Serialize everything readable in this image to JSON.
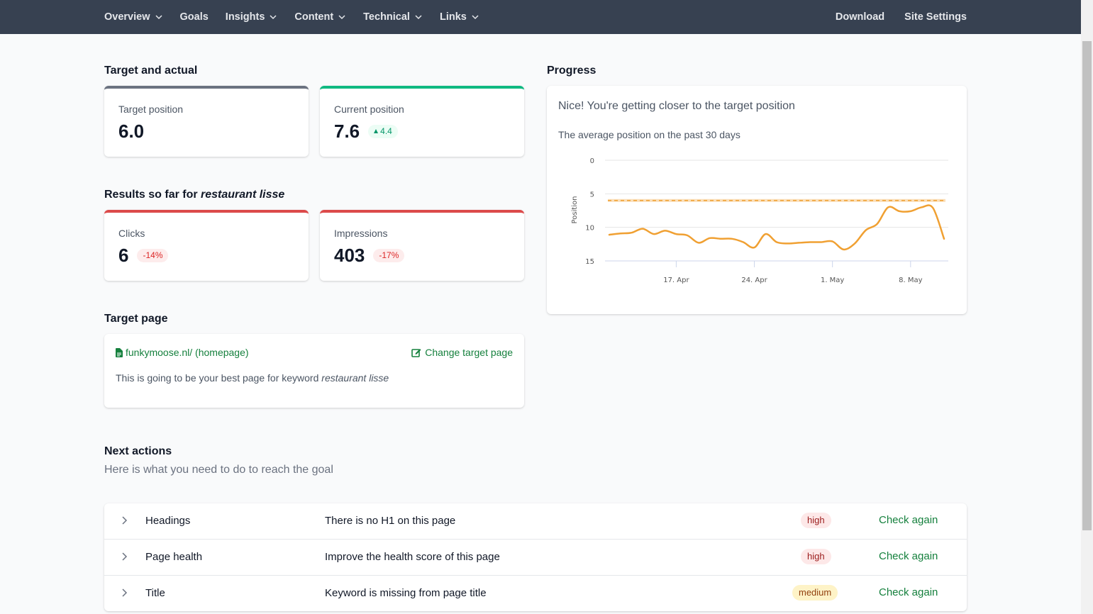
{
  "nav": {
    "left": [
      {
        "label": "Overview",
        "dropdown": true
      },
      {
        "label": "Goals",
        "dropdown": false
      },
      {
        "label": "Insights",
        "dropdown": true
      },
      {
        "label": "Content",
        "dropdown": true
      },
      {
        "label": "Technical",
        "dropdown": true
      },
      {
        "label": "Links",
        "dropdown": true
      }
    ],
    "right": [
      {
        "label": "Download"
      },
      {
        "label": "Site Settings"
      }
    ]
  },
  "target_actual": {
    "title": "Target and actual",
    "target": {
      "label": "Target position",
      "value": "6.0"
    },
    "current": {
      "label": "Current position",
      "value": "7.6",
      "change": "4.4",
      "change_direction": "up"
    }
  },
  "results": {
    "title_prefix": "Results so far for ",
    "keyword": "restaurant lisse",
    "clicks": {
      "label": "Clicks",
      "value": "6",
      "change": "-14%"
    },
    "impressions": {
      "label": "Impressions",
      "value": "403",
      "change": "-17%"
    }
  },
  "target_page": {
    "title": "Target page",
    "link": "funkymoose.nl/ (homepage)",
    "change_label": "Change target page",
    "desc_prefix": "This is going to be your best page for keyword ",
    "keyword": "restaurant lisse"
  },
  "progress": {
    "title": "Progress",
    "headline": "Nice! You're getting closer to the target position",
    "subtitle": "The average position on the past 30 days"
  },
  "chart_data": {
    "type": "line",
    "ylabel": "Position",
    "y_reversed": true,
    "ylim": [
      0,
      15
    ],
    "yticks": [
      "0",
      "5",
      "10",
      "15"
    ],
    "xticks": [
      {
        "date": "2024-04-17",
        "label": "17. Apr"
      },
      {
        "date": "2024-04-24",
        "label": "24. Apr"
      },
      {
        "date": "2024-05-01",
        "label": "1. May"
      },
      {
        "date": "2024-05-08",
        "label": "8. May"
      }
    ],
    "x_start": "2024-04-11",
    "x_end": "2024-05-11",
    "grid": true,
    "target_line": 6.0,
    "series": [
      {
        "color": "#f0a032",
        "points": [
          [
            "2024-04-11",
            11.1
          ],
          [
            "2024-04-12",
            10.9
          ],
          [
            "2024-04-13",
            10.8
          ],
          [
            "2024-04-14",
            10.2
          ],
          [
            "2024-04-15",
            11.0
          ],
          [
            "2024-04-16",
            10.5
          ],
          [
            "2024-04-17",
            11.0
          ],
          [
            "2024-04-18",
            11.2
          ],
          [
            "2024-04-19",
            12.3
          ],
          [
            "2024-04-20",
            11.6
          ],
          [
            "2024-04-21",
            11.7
          ],
          [
            "2024-04-22",
            11.7
          ],
          [
            "2024-04-23",
            12.2
          ],
          [
            "2024-04-24",
            13.0
          ],
          [
            "2024-04-25",
            11.0
          ],
          [
            "2024-04-26",
            12.2
          ],
          [
            "2024-04-27",
            12.4
          ],
          [
            "2024-04-28",
            12.3
          ],
          [
            "2024-04-29",
            12.2
          ],
          [
            "2024-04-30",
            12.2
          ],
          [
            "2024-05-01",
            12.1
          ],
          [
            "2024-05-02",
            13.3
          ],
          [
            "2024-05-03",
            12.4
          ],
          [
            "2024-05-04",
            10.4
          ],
          [
            "2024-05-05",
            9.5
          ],
          [
            "2024-05-06",
            7.0
          ],
          [
            "2024-05-07",
            7.6
          ],
          [
            "2024-05-08",
            7.6
          ],
          [
            "2024-05-09",
            7.0
          ],
          [
            "2024-05-10",
            7.1
          ],
          [
            "2024-05-11",
            11.7
          ]
        ]
      }
    ]
  },
  "next_actions": {
    "title": "Next actions",
    "subtitle": "Here is what you need to do to reach the goal",
    "rows": [
      {
        "name": "Headings",
        "desc": "There is no H1 on this page",
        "priority": "high",
        "action": "Check again"
      },
      {
        "name": "Page health",
        "desc": "Improve the health score of this page",
        "priority": "high",
        "action": "Check again"
      },
      {
        "name": "Title",
        "desc": "Keyword is missing from page title",
        "priority": "medium",
        "action": "Check again"
      }
    ]
  },
  "colors": {
    "nav_bg": "#374151",
    "accent_green": "#15803d",
    "danger": "#dc4a4a",
    "success": "#10b981",
    "chart_line": "#f0a032"
  },
  "icons": {
    "dropdown": "chevron-down-icon",
    "file": "file-icon",
    "edit": "edit-icon",
    "expand": "chevron-right-icon",
    "trend_up": "triangle-up-icon"
  }
}
